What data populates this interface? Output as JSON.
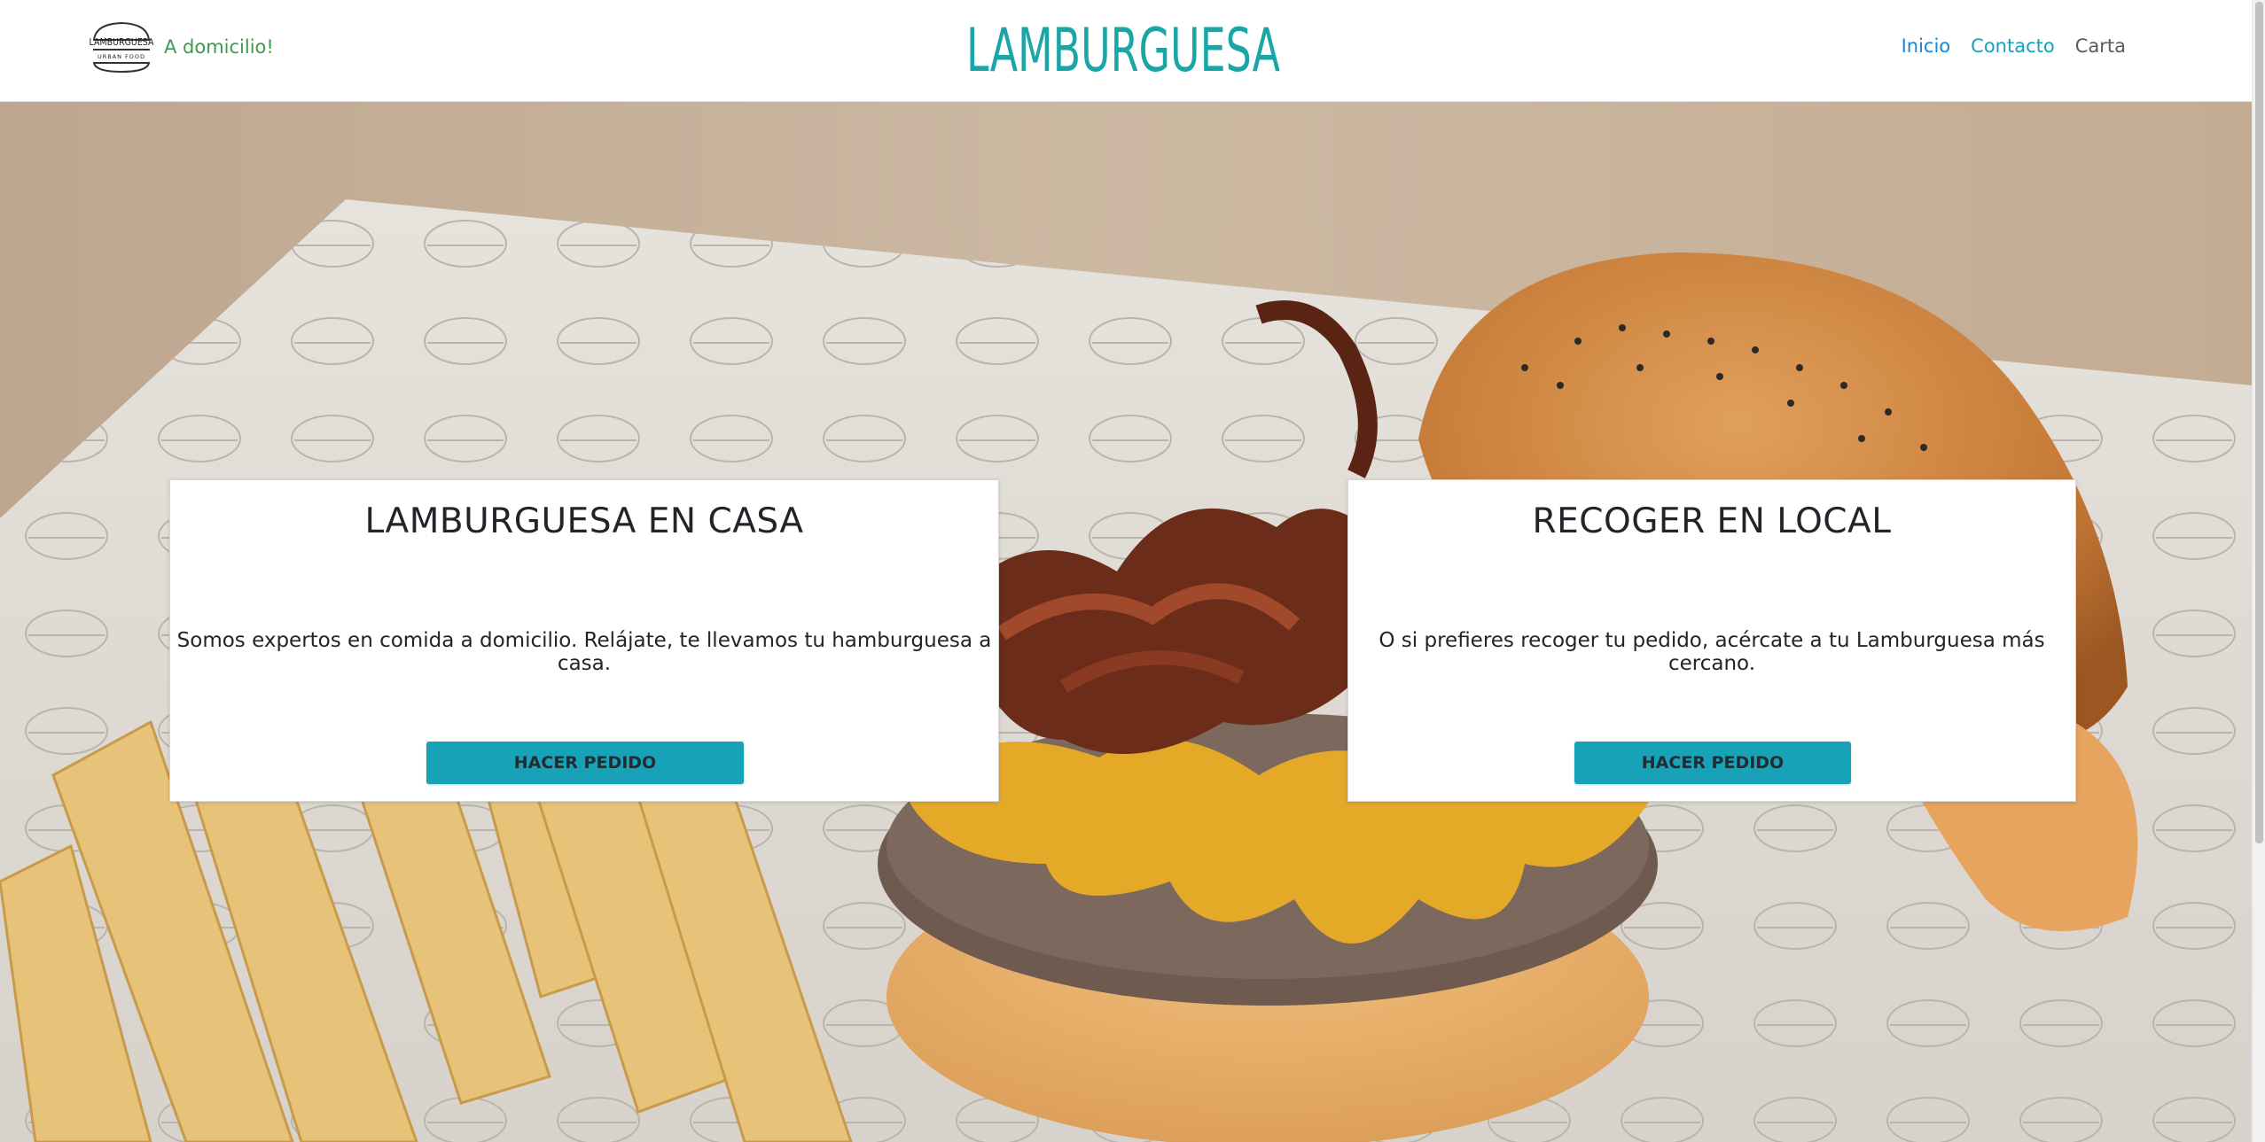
{
  "header": {
    "logo_text": "LAMBURGUESA",
    "logo_subtext": "URBAN FOOD",
    "tagline": "A domicilio!",
    "wordmark": "LAMBURGUESA",
    "nav": [
      {
        "label": "Inicio"
      },
      {
        "label": "Contacto"
      },
      {
        "label": "Carta"
      }
    ]
  },
  "cards": [
    {
      "title": "LAMBURGUESA EN CASA",
      "text": "Somos expertos en comida a domicilio. Relájate, te llevamos tu hamburguesa a casa.",
      "button": "HACER PEDIDO"
    },
    {
      "title": "RECOGER EN LOCAL",
      "text": "O si prefieres recoger tu pedido, acércate a tu Lamburguesa más cercano.",
      "button": "HACER PEDIDO"
    }
  ],
  "colors": {
    "accent": "#17a2b8",
    "tagline": "#3f9a4c",
    "nav_active": "#1b86d6"
  },
  "icons": {
    "logo": "burger-logo-icon",
    "hero": "burger-and-fries-photo"
  }
}
